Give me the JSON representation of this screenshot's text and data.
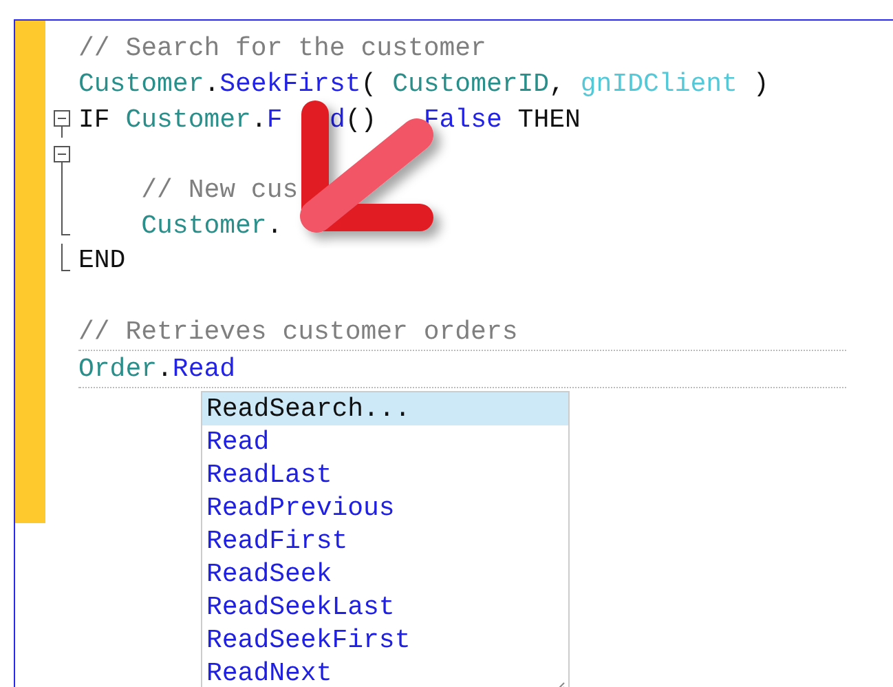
{
  "editor": {
    "lines": [
      {
        "kind": "code",
        "dotted": false,
        "tokens": [
          {
            "text": "// Search for the customer",
            "kind": "comment"
          }
        ]
      },
      {
        "kind": "code",
        "dotted": false,
        "tokens": [
          {
            "text": "Customer",
            "kind": "object"
          },
          {
            "text": ".",
            "kind": "plain"
          },
          {
            "text": "SeekFirst",
            "kind": "method"
          },
          {
            "text": "( ",
            "kind": "plain"
          },
          {
            "text": "CustomerID",
            "kind": "object"
          },
          {
            "text": ", ",
            "kind": "plain"
          },
          {
            "text": "gnIDClient",
            "kind": "variable"
          },
          {
            "text": " )",
            "kind": "plain"
          }
        ]
      },
      {
        "kind": "fold-start",
        "dotted": false,
        "tokens": [
          {
            "text": "IF ",
            "kind": "keyword"
          },
          {
            "text": "Customer",
            "kind": "object"
          },
          {
            "text": ".",
            "kind": "plain"
          },
          {
            "text": "F",
            "kind": "method"
          },
          {
            "kind": "covered"
          },
          {
            "text": "d",
            "kind": "method"
          },
          {
            "text": "()",
            "kind": "plain"
          },
          {
            "kind": "covered"
          },
          {
            "text": "False",
            "kind": "method"
          },
          {
            "text": " THEN",
            "kind": "keyword"
          }
        ]
      },
      {
        "kind": "fold-nested",
        "dotted": false
      },
      {
        "kind": "fold-inner",
        "dotted": false,
        "tokens": [
          {
            "text": "    // New cus",
            "kind": "comment"
          }
        ]
      },
      {
        "kind": "fold-end",
        "dotted": false,
        "tokens": [
          {
            "text": "    Customer",
            "kind": "object"
          },
          {
            "text": ".",
            "kind": "plain"
          }
        ]
      },
      {
        "kind": "fold-end",
        "dotted": false,
        "tokens": [
          {
            "text": "END",
            "kind": "keyword"
          }
        ]
      },
      {
        "kind": "code",
        "dotted": false
      },
      {
        "kind": "code",
        "dotted": true,
        "tokens": [
          {
            "text": "// Retrieves customer orders",
            "kind": "comment"
          }
        ]
      },
      {
        "kind": "code",
        "dotted": true,
        "tokens": [
          {
            "text": "Order",
            "kind": "object"
          },
          {
            "text": ".",
            "kind": "plain"
          },
          {
            "text": "Read",
            "kind": "method"
          }
        ]
      }
    ],
    "autocomplete": {
      "items": [
        {
          "label": "ReadSearch...",
          "selected": true
        },
        {
          "label": "Read",
          "selected": false
        },
        {
          "label": "ReadLast",
          "selected": false
        },
        {
          "label": "ReadPrevious",
          "selected": false
        },
        {
          "label": "ReadFirst",
          "selected": false
        },
        {
          "label": "ReadSeek",
          "selected": false
        },
        {
          "label": "ReadSeekLast",
          "selected": false
        },
        {
          "label": "ReadSeekFirst",
          "selected": false
        },
        {
          "label": "ReadNext",
          "selected": false
        }
      ]
    }
  }
}
